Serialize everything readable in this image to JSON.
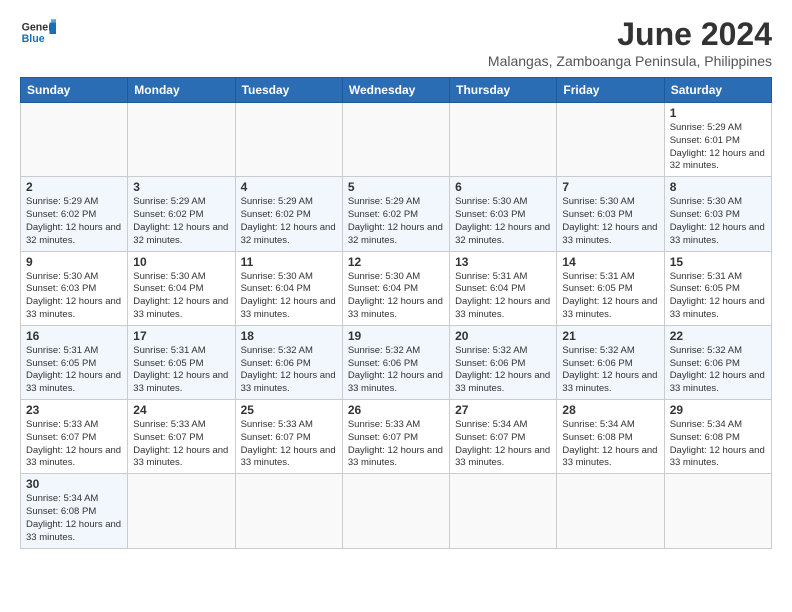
{
  "header": {
    "logo_general": "General",
    "logo_blue": "Blue",
    "main_title": "June 2024",
    "subtitle": "Malangas, Zamboanga Peninsula, Philippines"
  },
  "weekdays": [
    "Sunday",
    "Monday",
    "Tuesday",
    "Wednesday",
    "Thursday",
    "Friday",
    "Saturday"
  ],
  "weeks": [
    [
      {
        "day": "",
        "info": ""
      },
      {
        "day": "",
        "info": ""
      },
      {
        "day": "",
        "info": ""
      },
      {
        "day": "",
        "info": ""
      },
      {
        "day": "",
        "info": ""
      },
      {
        "day": "",
        "info": ""
      },
      {
        "day": "1",
        "info": "Sunrise: 5:29 AM\nSunset: 6:01 PM\nDaylight: 12 hours and 32 minutes."
      }
    ],
    [
      {
        "day": "2",
        "info": "Sunrise: 5:29 AM\nSunset: 6:02 PM\nDaylight: 12 hours and 32 minutes."
      },
      {
        "day": "3",
        "info": "Sunrise: 5:29 AM\nSunset: 6:02 PM\nDaylight: 12 hours and 32 minutes."
      },
      {
        "day": "4",
        "info": "Sunrise: 5:29 AM\nSunset: 6:02 PM\nDaylight: 12 hours and 32 minutes."
      },
      {
        "day": "5",
        "info": "Sunrise: 5:29 AM\nSunset: 6:02 PM\nDaylight: 12 hours and 32 minutes."
      },
      {
        "day": "6",
        "info": "Sunrise: 5:30 AM\nSunset: 6:03 PM\nDaylight: 12 hours and 32 minutes."
      },
      {
        "day": "7",
        "info": "Sunrise: 5:30 AM\nSunset: 6:03 PM\nDaylight: 12 hours and 33 minutes."
      },
      {
        "day": "8",
        "info": "Sunrise: 5:30 AM\nSunset: 6:03 PM\nDaylight: 12 hours and 33 minutes."
      }
    ],
    [
      {
        "day": "9",
        "info": "Sunrise: 5:30 AM\nSunset: 6:03 PM\nDaylight: 12 hours and 33 minutes."
      },
      {
        "day": "10",
        "info": "Sunrise: 5:30 AM\nSunset: 6:04 PM\nDaylight: 12 hours and 33 minutes."
      },
      {
        "day": "11",
        "info": "Sunrise: 5:30 AM\nSunset: 6:04 PM\nDaylight: 12 hours and 33 minutes."
      },
      {
        "day": "12",
        "info": "Sunrise: 5:30 AM\nSunset: 6:04 PM\nDaylight: 12 hours and 33 minutes."
      },
      {
        "day": "13",
        "info": "Sunrise: 5:31 AM\nSunset: 6:04 PM\nDaylight: 12 hours and 33 minutes."
      },
      {
        "day": "14",
        "info": "Sunrise: 5:31 AM\nSunset: 6:05 PM\nDaylight: 12 hours and 33 minutes."
      },
      {
        "day": "15",
        "info": "Sunrise: 5:31 AM\nSunset: 6:05 PM\nDaylight: 12 hours and 33 minutes."
      }
    ],
    [
      {
        "day": "16",
        "info": "Sunrise: 5:31 AM\nSunset: 6:05 PM\nDaylight: 12 hours and 33 minutes."
      },
      {
        "day": "17",
        "info": "Sunrise: 5:31 AM\nSunset: 6:05 PM\nDaylight: 12 hours and 33 minutes."
      },
      {
        "day": "18",
        "info": "Sunrise: 5:32 AM\nSunset: 6:06 PM\nDaylight: 12 hours and 33 minutes."
      },
      {
        "day": "19",
        "info": "Sunrise: 5:32 AM\nSunset: 6:06 PM\nDaylight: 12 hours and 33 minutes."
      },
      {
        "day": "20",
        "info": "Sunrise: 5:32 AM\nSunset: 6:06 PM\nDaylight: 12 hours and 33 minutes."
      },
      {
        "day": "21",
        "info": "Sunrise: 5:32 AM\nSunset: 6:06 PM\nDaylight: 12 hours and 33 minutes."
      },
      {
        "day": "22",
        "info": "Sunrise: 5:32 AM\nSunset: 6:06 PM\nDaylight: 12 hours and 33 minutes."
      }
    ],
    [
      {
        "day": "23",
        "info": "Sunrise: 5:33 AM\nSunset: 6:07 PM\nDaylight: 12 hours and 33 minutes."
      },
      {
        "day": "24",
        "info": "Sunrise: 5:33 AM\nSunset: 6:07 PM\nDaylight: 12 hours and 33 minutes."
      },
      {
        "day": "25",
        "info": "Sunrise: 5:33 AM\nSunset: 6:07 PM\nDaylight: 12 hours and 33 minutes."
      },
      {
        "day": "26",
        "info": "Sunrise: 5:33 AM\nSunset: 6:07 PM\nDaylight: 12 hours and 33 minutes."
      },
      {
        "day": "27",
        "info": "Sunrise: 5:34 AM\nSunset: 6:07 PM\nDaylight: 12 hours and 33 minutes."
      },
      {
        "day": "28",
        "info": "Sunrise: 5:34 AM\nSunset: 6:08 PM\nDaylight: 12 hours and 33 minutes."
      },
      {
        "day": "29",
        "info": "Sunrise: 5:34 AM\nSunset: 6:08 PM\nDaylight: 12 hours and 33 minutes."
      }
    ],
    [
      {
        "day": "30",
        "info": "Sunrise: 5:34 AM\nSunset: 6:08 PM\nDaylight: 12 hours and 33 minutes."
      },
      {
        "day": "",
        "info": ""
      },
      {
        "day": "",
        "info": ""
      },
      {
        "day": "",
        "info": ""
      },
      {
        "day": "",
        "info": ""
      },
      {
        "day": "",
        "info": ""
      },
      {
        "day": "",
        "info": ""
      }
    ]
  ]
}
